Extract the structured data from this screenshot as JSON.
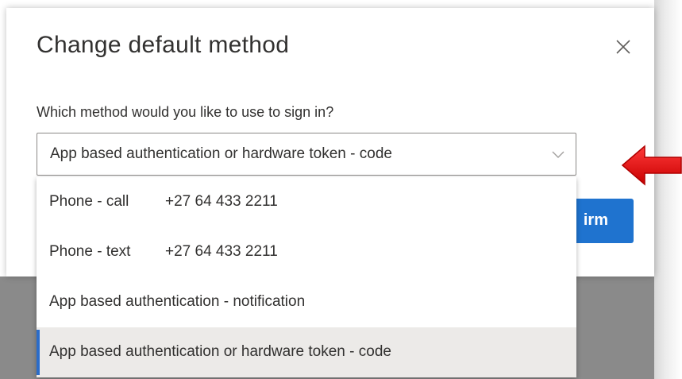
{
  "dialog": {
    "title": "Change default method",
    "close_icon": "close-icon"
  },
  "form": {
    "label": "Which method would you like to use to sign in?",
    "selected_value": "App based authentication or hardware token - code",
    "chevron_icon": "chevron-down-icon"
  },
  "confirm_button": {
    "label_visible": "irm"
  },
  "dropdown": {
    "options": [
      {
        "label": "Phone - call",
        "phone": "+27 64 433 2211",
        "selected": false
      },
      {
        "label": "Phone - text",
        "phone": "+27 64 433 2211",
        "selected": false
      },
      {
        "label": "App based authentication - notification",
        "phone": "",
        "selected": false
      },
      {
        "label": "App based authentication or hardware token - code",
        "phone": "",
        "selected": true
      }
    ]
  },
  "annotation": {
    "arrow_icon": "red-left-arrow-icon",
    "arrow_color": "#e01010"
  },
  "colors": {
    "accent": "#1f73cf",
    "selection_bar": "#2b6cc9",
    "selected_bg": "#eceae8",
    "overlay": "#8a8a8a"
  }
}
